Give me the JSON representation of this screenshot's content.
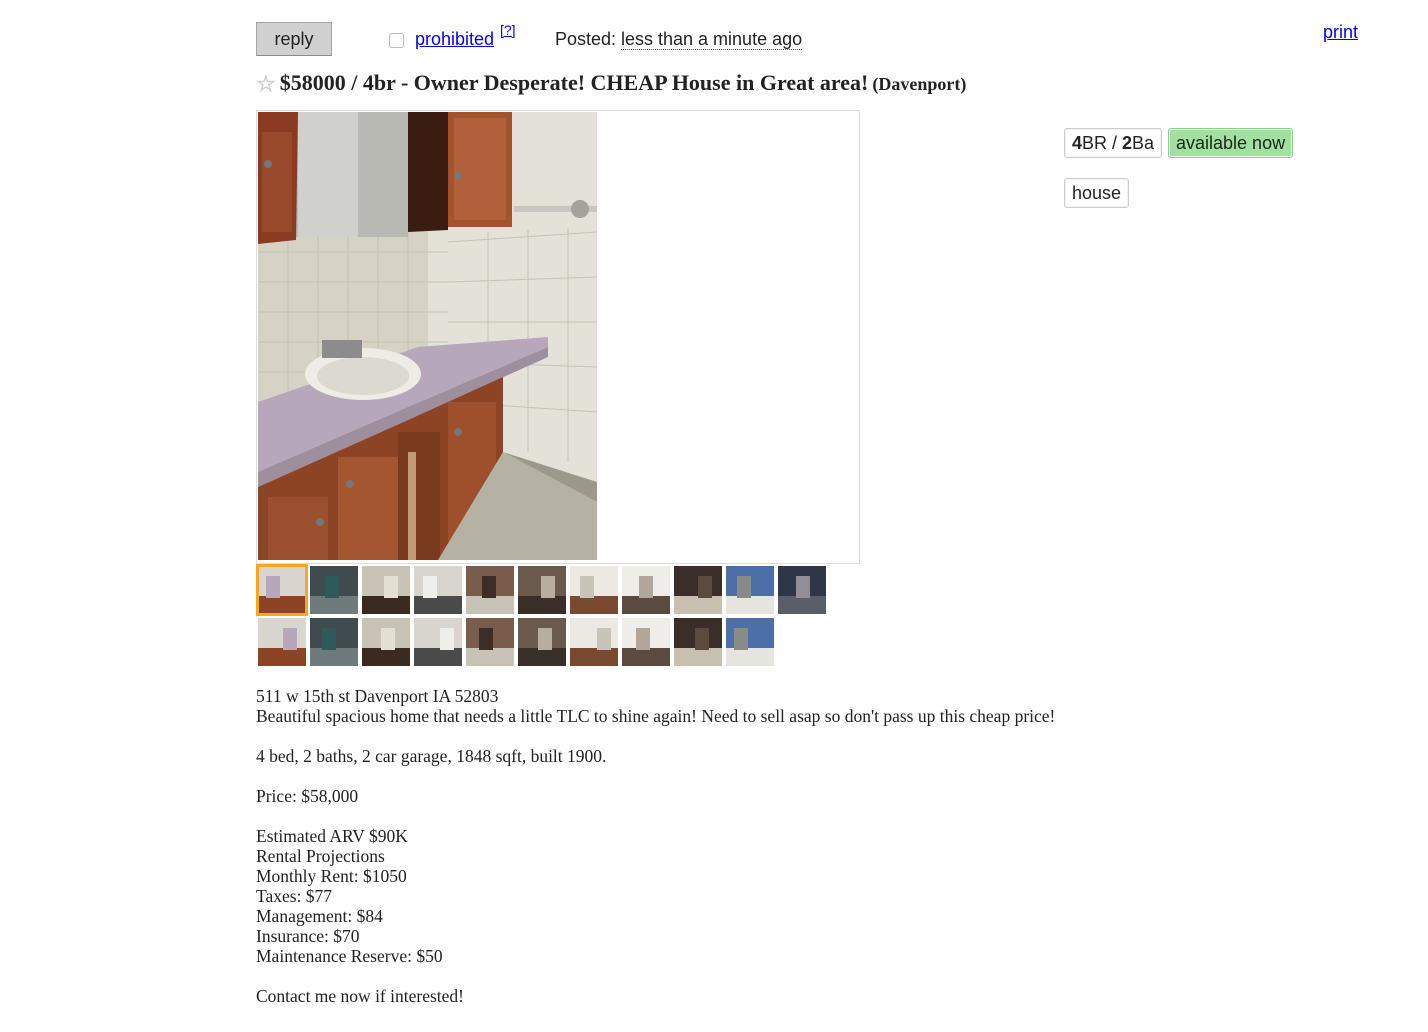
{
  "topbar": {
    "reply_label": "reply",
    "prohibited_label": "prohibited",
    "help_label": "[?]",
    "posted_label": "Posted:",
    "posted_time": "less than a minute ago",
    "print_label": "print"
  },
  "title": {
    "star": "☆",
    "text": "$58000 / 4br - Owner Desperate! CHEAP House in Great area!",
    "location": "(Davenport)"
  },
  "attributes": {
    "bedrooms": "4",
    "br_suffix": "BR / ",
    "bathrooms": "2",
    "ba_suffix": "Ba",
    "availability": "available now",
    "housing_type": "house"
  },
  "thumbnails": [
    {
      "icon": "bathroom-vanity-photo",
      "selected": true
    },
    {
      "icon": "room-photo",
      "selected": false
    },
    {
      "icon": "ceiling-photo",
      "selected": false
    },
    {
      "icon": "kitchen-photo",
      "selected": false
    },
    {
      "icon": "kitchen-stove-photo",
      "selected": false
    },
    {
      "icon": "interior-photo",
      "selected": false
    },
    {
      "icon": "doorway-photo",
      "selected": false
    },
    {
      "icon": "living-room-photo",
      "selected": false
    },
    {
      "icon": "room-window-photo",
      "selected": false
    },
    {
      "icon": "exterior-photo",
      "selected": false
    },
    {
      "icon": "roof-photo",
      "selected": false
    },
    {
      "icon": "exterior-stairs-photo",
      "selected": false
    },
    {
      "icon": "exterior-stairs-photo",
      "selected": false
    },
    {
      "icon": "ceiling-damage-photo",
      "selected": false
    },
    {
      "icon": "kitchen-photo",
      "selected": false
    },
    {
      "icon": "dark-room-photo",
      "selected": false
    },
    {
      "icon": "staircase-photo",
      "selected": false
    },
    {
      "icon": "back-porch-photo",
      "selected": false
    },
    {
      "icon": "house-side-photo",
      "selected": false
    },
    {
      "icon": "house-front-photo",
      "selected": false
    },
    {
      "icon": "house-front-photo",
      "selected": false
    }
  ],
  "body": {
    "lines": [
      "511 w 15th st Davenport IA 52803",
      "Beautiful spacious home that needs a little TLC to shine again! Need to sell asap so don't pass up this cheap price!",
      "",
      "4 bed, 2 baths, 2 car garage, 1848 sqft, built 1900.",
      "",
      "Price: $58,000",
      "",
      "Estimated ARV $90K",
      "Rental Projections",
      "Monthly Rent: $1050",
      "Taxes: $77",
      "Management: $84",
      "Insurance: $70",
      "Maintenance Reserve: $50",
      "",
      "Contact me now if interested!"
    ]
  },
  "colors": {
    "link": "#0000ee",
    "available_badge": "#9de29d",
    "selected_thumb_outline": "#f5a623",
    "reply_button": "#d0d0d0"
  }
}
